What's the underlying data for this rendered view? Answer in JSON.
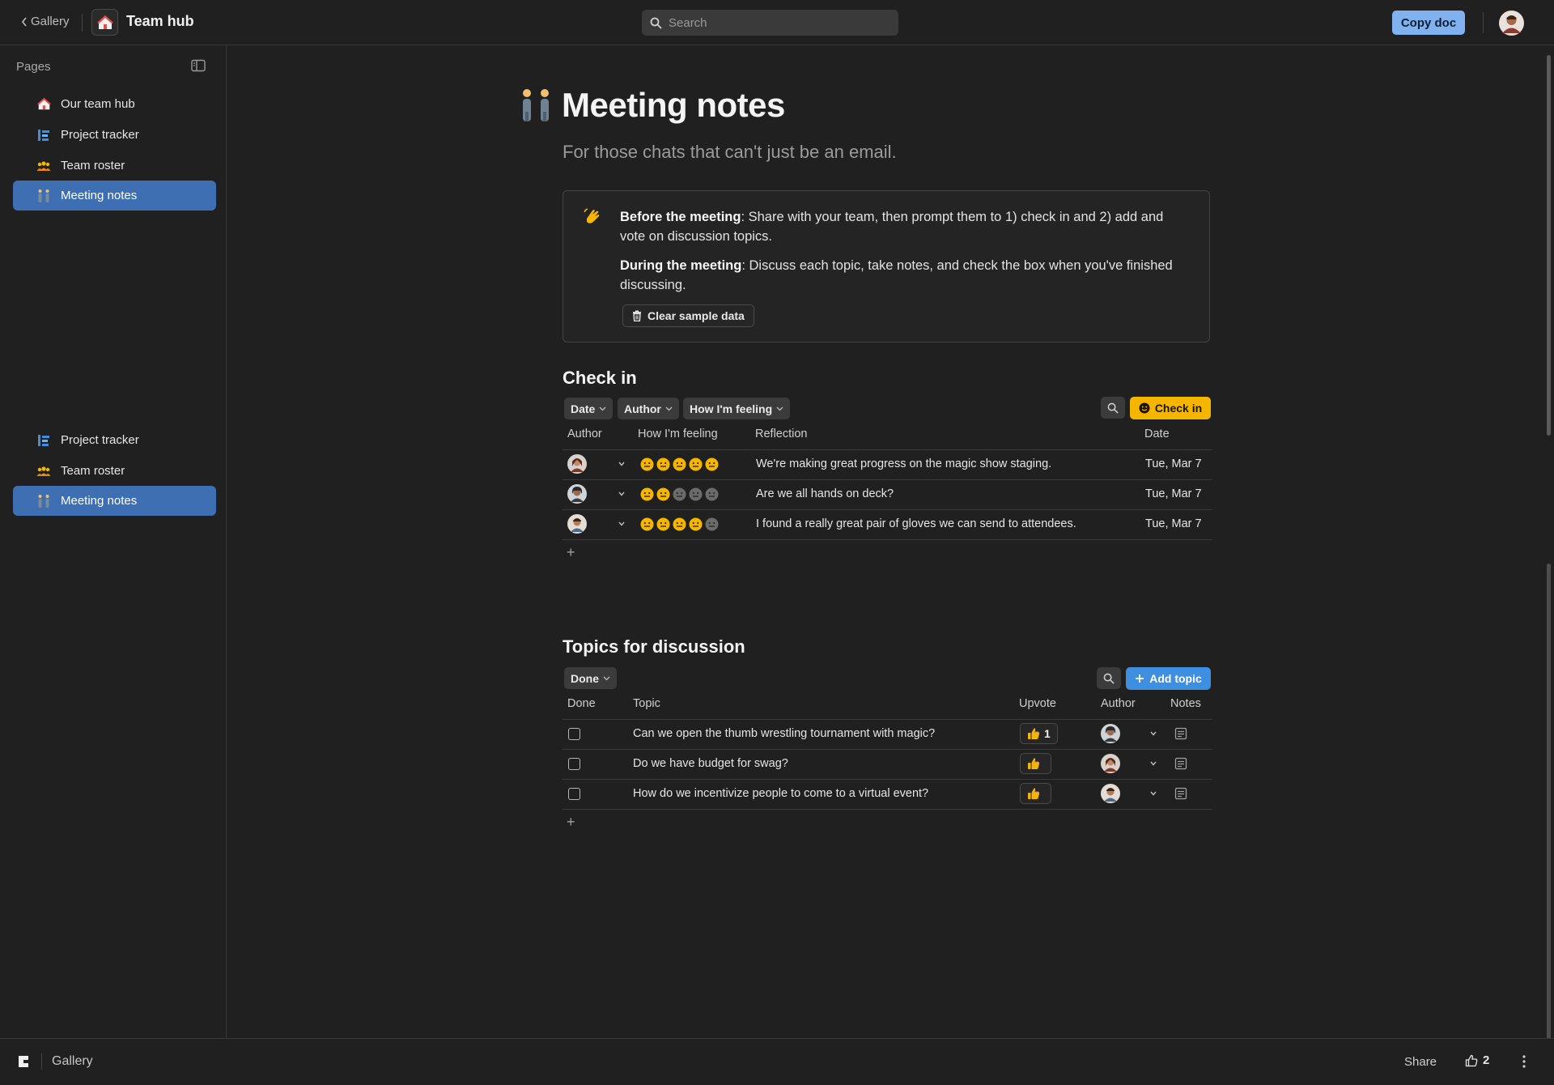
{
  "topbar": {
    "back_label": "Gallery",
    "doc_title": "Team hub",
    "search_placeholder": "Search",
    "copy_label": "Copy doc"
  },
  "sidebar": {
    "header": "Pages",
    "items": [
      {
        "label": "Our team hub",
        "icon": "house-icon"
      },
      {
        "label": "Project tracker",
        "icon": "tracker-icon"
      },
      {
        "label": "Team roster",
        "icon": "people-icon"
      },
      {
        "label": "Meeting notes",
        "icon": "meeting-icon",
        "active": true
      }
    ],
    "items_lower": [
      {
        "label": "Project tracker",
        "icon": "tracker-icon"
      },
      {
        "label": "Team roster",
        "icon": "people-icon"
      },
      {
        "label": "Meeting notes",
        "icon": "meeting-icon",
        "active": true
      }
    ]
  },
  "page": {
    "title": "Meeting notes",
    "subtitle": "For those chats that can't just be an email."
  },
  "callout": {
    "p1_bold": "Before the meeting",
    "p1_text": ": Share with your team, then prompt them to 1) check in and 2) add and vote on discussion topics.",
    "p2_bold": "During the meeting",
    "p2_text": ": Discuss each topic, take notes, and check the box when you've finished discussing.",
    "clear_label": "Clear sample data"
  },
  "checkin": {
    "title": "Check in",
    "filters": [
      "Date",
      "Author",
      "How I'm feeling"
    ],
    "button_label": "Check in",
    "columns": [
      "Author",
      "How I'm feeling",
      "Reflection",
      "Date"
    ],
    "rows": [
      {
        "feeling": 5,
        "reflection": "We're making great progress on the magic show staging.",
        "date": "Tue, Mar 7"
      },
      {
        "feeling": 2,
        "reflection": "Are we all hands on deck?",
        "date": "Tue, Mar 7"
      },
      {
        "feeling": 4,
        "reflection": "I found a really great pair of gloves we can send to attendees.",
        "date": "Tue, Mar 7"
      }
    ],
    "add_symbol": "+"
  },
  "topics": {
    "title": "Topics for discussion",
    "filters": [
      "Done"
    ],
    "button_label": "Add topic",
    "columns": [
      "Done",
      "Topic",
      "Upvote",
      "Author",
      "Notes"
    ],
    "rows": [
      {
        "done": false,
        "topic": "Can we open the thumb wrestling tournament with magic?",
        "upvotes": "1"
      },
      {
        "done": false,
        "topic": "Do we have budget for swag?",
        "upvotes": ""
      },
      {
        "done": false,
        "topic": "How do we incentivize people to come to a virtual event?",
        "upvotes": ""
      }
    ],
    "add_symbol": "+"
  },
  "footer": {
    "gallery_label": "Gallery",
    "share_label": "Share",
    "like_count": "2"
  },
  "colors": {
    "accent_blue": "#3e6fb3",
    "check_in_yellow": "#f5b600",
    "add_topic_blue": "#3f8fe0",
    "copy_doc_blue": "#7fb2ee",
    "feeling_face_on": "#f5b600",
    "feeling_face_off": "#6b6b6b"
  }
}
